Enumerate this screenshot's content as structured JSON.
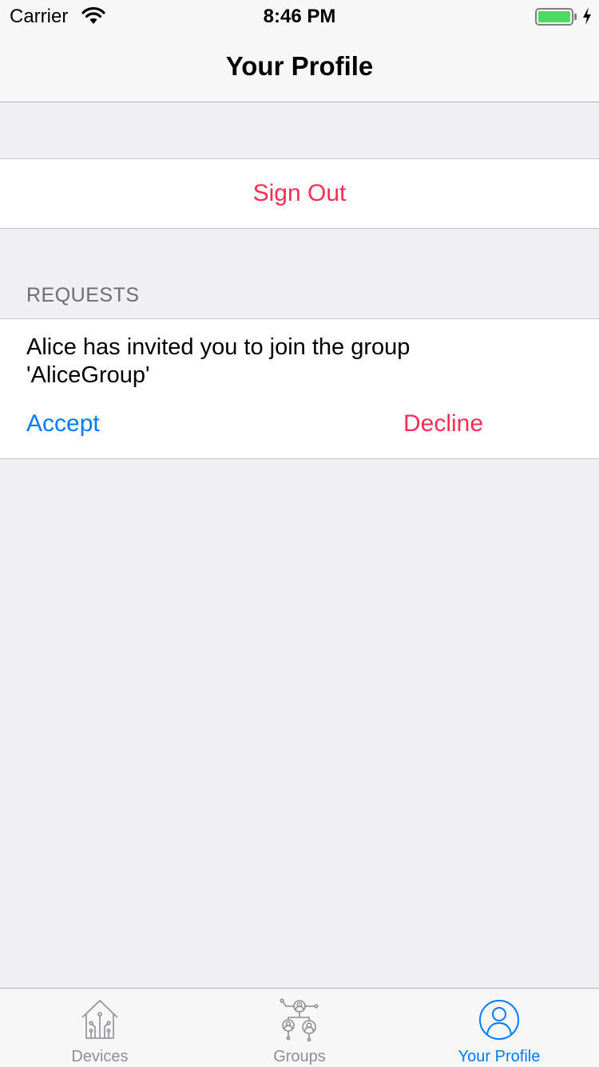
{
  "status_bar": {
    "carrier": "Carrier",
    "time": "8:46 PM",
    "wifi_icon": "wifi-icon",
    "battery_icon": "battery-charging-icon"
  },
  "nav": {
    "title": "Your Profile"
  },
  "account": {
    "sign_out_label": "Sign Out"
  },
  "requests": {
    "header": "REQUESTS",
    "items": [
      {
        "message": "Alice has invited you to join the group 'AliceGroup'",
        "accept_label": "Accept",
        "decline_label": "Decline"
      }
    ]
  },
  "tab_bar": {
    "tabs": [
      {
        "label": "Devices",
        "icon": "house-circuit-icon",
        "active": false
      },
      {
        "label": "Groups",
        "icon": "group-network-icon",
        "active": false
      },
      {
        "label": "Your Profile",
        "icon": "person-circle-icon",
        "active": true
      }
    ]
  },
  "colors": {
    "accent": "#007aff",
    "destructive": "#ff2d55",
    "background": "#efeff4",
    "inactive": "#8e8e93",
    "battery": "#4cd964"
  }
}
